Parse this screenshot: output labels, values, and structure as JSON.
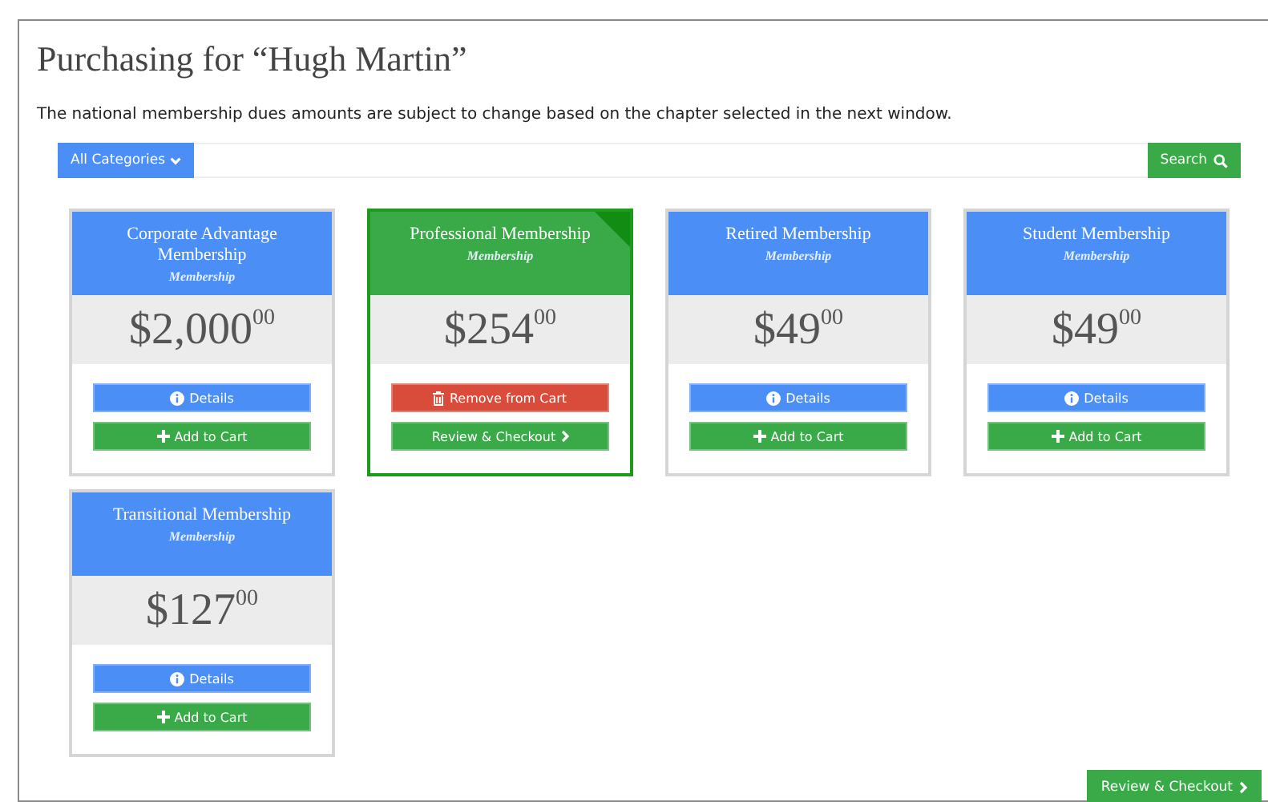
{
  "title": "Purchasing for “Hugh Martin”",
  "notice": "The national membership dues amounts are subject to change based on the chapter selected in the next window.",
  "toolbar": {
    "category_button": "All Categories",
    "search_button": "Search"
  },
  "products": [
    {
      "name": "Corporate Advantage Membership",
      "category": "Membership",
      "dollars": "$2,000",
      "cents": "00",
      "in_cart": false,
      "buttons": [
        {
          "kind": "details",
          "label": "Details"
        },
        {
          "kind": "add",
          "label": "Add to Cart"
        }
      ]
    },
    {
      "name": "Professional Membership",
      "category": "Membership",
      "dollars": "$254",
      "cents": "00",
      "in_cart": true,
      "buttons": [
        {
          "kind": "remove",
          "label": "Remove from Cart"
        },
        {
          "kind": "checkout",
          "label": "Review & Checkout"
        }
      ]
    },
    {
      "name": "Retired Membership",
      "category": "Membership",
      "dollars": "$49",
      "cents": "00",
      "in_cart": false,
      "buttons": [
        {
          "kind": "details",
          "label": "Details"
        },
        {
          "kind": "add",
          "label": "Add to Cart"
        }
      ]
    },
    {
      "name": "Student Membership",
      "category": "Membership",
      "dollars": "$49",
      "cents": "00",
      "in_cart": false,
      "buttons": [
        {
          "kind": "details",
          "label": "Details"
        },
        {
          "kind": "add",
          "label": "Add to Cart"
        }
      ]
    },
    {
      "name": "Transitional Membership",
      "category": "Membership",
      "dollars": "$127",
      "cents": "00",
      "in_cart": false,
      "buttons": [
        {
          "kind": "details",
          "label": "Details"
        },
        {
          "kind": "add",
          "label": "Add to Cart"
        }
      ]
    }
  ],
  "checkout_button": "Review & Checkout"
}
